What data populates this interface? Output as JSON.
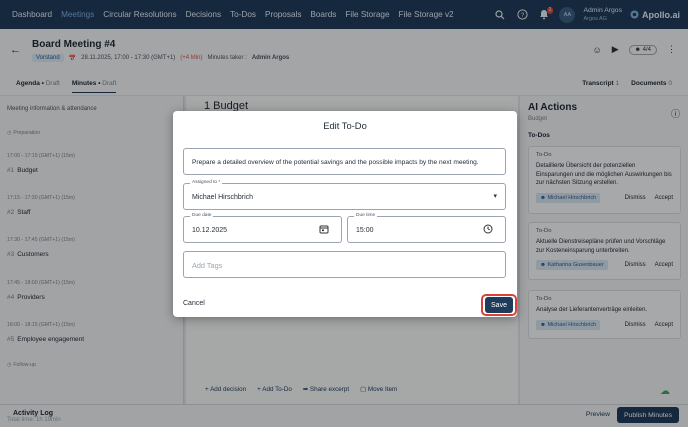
{
  "nav": {
    "items": [
      "Dashboard",
      "Meetings",
      "Circular Resolutions",
      "Decisions",
      "To-Dos",
      "Proposals",
      "Boards",
      "File Storage",
      "File Storage v2"
    ],
    "active_index": 1,
    "notification_count": "1",
    "user_initials": "AA",
    "user_name": "Admin Argos",
    "user_org": "Argos AG",
    "logo": "Apollo.ai"
  },
  "header": {
    "title": "Board Meeting #4",
    "status": "Vorstand",
    "datetime": "28.11.2025, 17:00 - 17:30 (GMT+1)",
    "late": "(+4 Min)",
    "minutes_taker_label": "Minutes taker :",
    "minutes_taker": "Admin Argos",
    "participants": "4/4"
  },
  "tabs": [
    {
      "label": "Agenda",
      "suffix": "Draft"
    },
    {
      "label": "Minutes",
      "suffix": "Draft"
    }
  ],
  "right_tabs": [
    {
      "label": "Transcript",
      "count": "1"
    },
    {
      "label": "Documents",
      "count": "0"
    }
  ],
  "left_panel": {
    "title": "Meeting information & attendance",
    "preparation": "Preparation",
    "follow_up": "Follow-up",
    "agenda": [
      {
        "time": "17:00 - 17:15 (GMT+1) (15m)",
        "num": "#1",
        "name": "Budget"
      },
      {
        "time": "17:15 - 17:30 (GMT+1) (15m)",
        "num": "#2",
        "name": "Staff"
      },
      {
        "time": "17:30 - 17:45 (GMT+1) (15m)",
        "num": "#3",
        "name": "Customers"
      },
      {
        "time": "17:45 - 18:00 (GMT+1) (15m)",
        "num": "#4",
        "name": "Providers"
      },
      {
        "time": "18:00 - 18:15 (GMT+1) (15m)",
        "num": "#5",
        "name": "Employee engagement"
      }
    ]
  },
  "center": {
    "agenda_heading": "1 Budget",
    "actions": [
      "Add decision",
      "Add To-Do",
      "Share excerpt",
      "Move Item"
    ]
  },
  "ai_panel": {
    "title": "AI Actions",
    "subtitle": "Budget",
    "todos_label": "To-Dos",
    "cards": [
      {
        "label": "To-Do",
        "text": "Detaillierte Übersicht der potenziellen Einsparungen und die möglichen Auswirkungen bis zur nächsten Sitzung erstellen.",
        "assignee": "Michael Hirschbrich",
        "dismiss": "Dismiss",
        "accept": "Accept"
      },
      {
        "label": "To-Do",
        "text": "Aktuelle Dienstreisepläne prüfen und Vorschläge zur Kosteneinsparung unterbreiten.",
        "assignee": "Katharina Gusenbauer",
        "dismiss": "Dismiss",
        "accept": "Accept"
      },
      {
        "label": "To-Do",
        "text": "Analyse der Lieferantenverträge einleiten.",
        "assignee": "Michael Hirschbrich",
        "dismiss": "Dismiss",
        "accept": "Accept"
      }
    ]
  },
  "footer": {
    "activity_log": "Activity Log",
    "timer": "Total time: 1h 19min",
    "preview": "Preview",
    "publish": "Publish Minutes"
  },
  "modal": {
    "title": "Edit To-Do",
    "description": "Prepare a detailed overview of the potential savings and the possible impacts by the next meeting.",
    "assigned_label": "Assigned to *",
    "assigned_value": "Michael Hirschbrich",
    "due_date_label": "Due date",
    "due_date_value": "10.12.2025",
    "due_time_label": "Due time",
    "due_time_value": "15:00",
    "tags_placeholder": "Add Tags",
    "cancel": "Cancel",
    "save": "Save"
  },
  "colors": {
    "primary": "#1f3b5c",
    "highlight_ring": "#d9423b"
  }
}
